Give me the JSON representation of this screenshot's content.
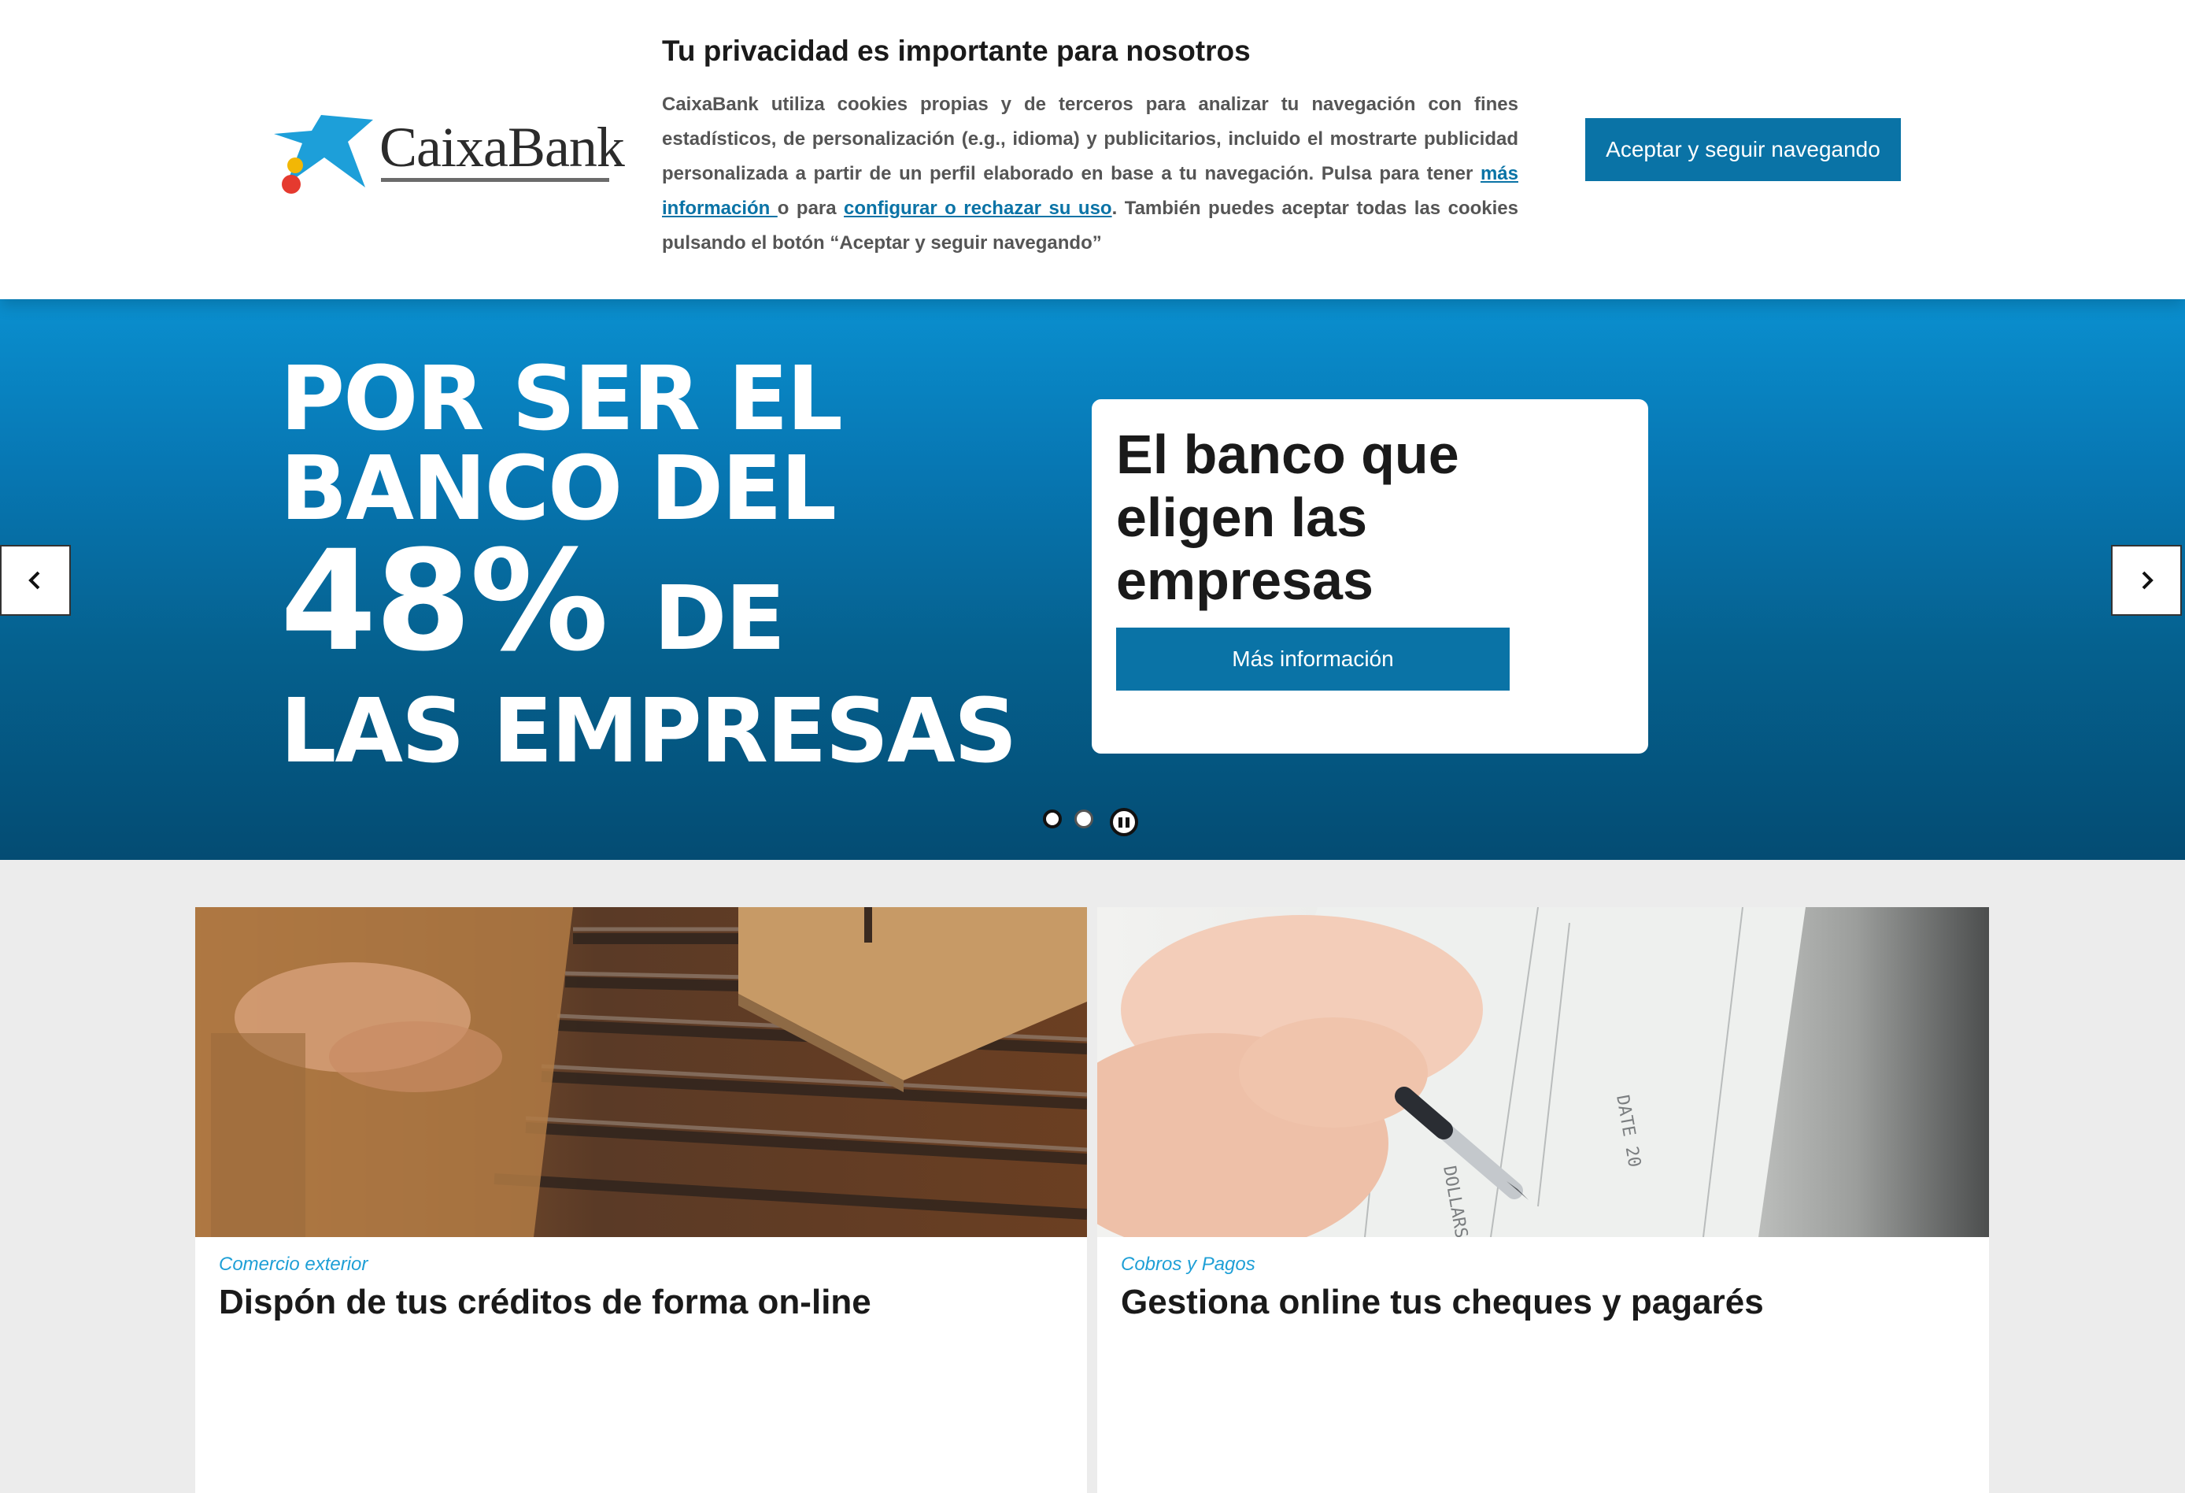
{
  "cookie_banner": {
    "logo_text": "CaixaBank",
    "title": "Tu privacidad es importante para nosotros",
    "text_part1": "CaixaBank utiliza cookies propias y de terceros para analizar tu navegación con fines estadísticos, de personalización (e.g., idioma) y publicitarios, incluido el mostrarte publicidad personalizada a partir de un perfil elaborado en base a tu navegación. Pulsa para tener ",
    "link_more_info": "más información ",
    "text_part2": "o para ",
    "link_configure": "configurar o rechazar su uso",
    "text_part3": ". También puedes aceptar todas las cookies pulsando el botón “Aceptar y seguir navegando”",
    "accept_button": "Aceptar y seguir navegando"
  },
  "hero": {
    "headline_line1": "POR SER EL",
    "headline_line2": "BANCO DEL",
    "headline_percent": "48%",
    "headline_de": "DE",
    "headline_line4": "LAS EMPRESAS",
    "card_title": "El banco que eligen las empresas",
    "card_button": "Más información",
    "slide_count": 2,
    "active_slide": 1
  },
  "cards": [
    {
      "category": "Comercio exterior",
      "title": "Dispón de tus créditos de forma on-line"
    },
    {
      "category": "Cobros y Pagos",
      "title": "Gestiona online tus cheques y pagarés"
    }
  ],
  "colors": {
    "brand_blue": "#0a73a6",
    "category_cyan": "#1e9fd6",
    "hero_top": "#0a8fcf",
    "hero_bottom": "#044c73",
    "page_bg": "#ececec"
  },
  "icons": [
    "chevron-left-icon",
    "chevron-right-icon",
    "pause-icon",
    "caixabank-star-logo"
  ]
}
